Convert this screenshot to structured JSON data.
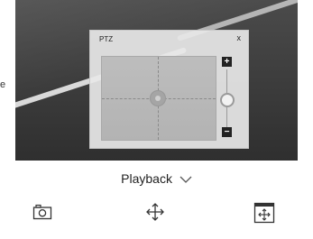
{
  "edge": {
    "text": "e"
  },
  "ptz": {
    "title": "PTZ",
    "close": "x",
    "zoom_in": "+",
    "zoom_out": "−"
  },
  "playback": {
    "label": "Playback"
  },
  "icons": {
    "snapshot": "camera-icon",
    "ptz_control": "move-arrows-icon",
    "ptz_window": "ptz-window-icon",
    "dropdown": "chevron-down-icon"
  }
}
